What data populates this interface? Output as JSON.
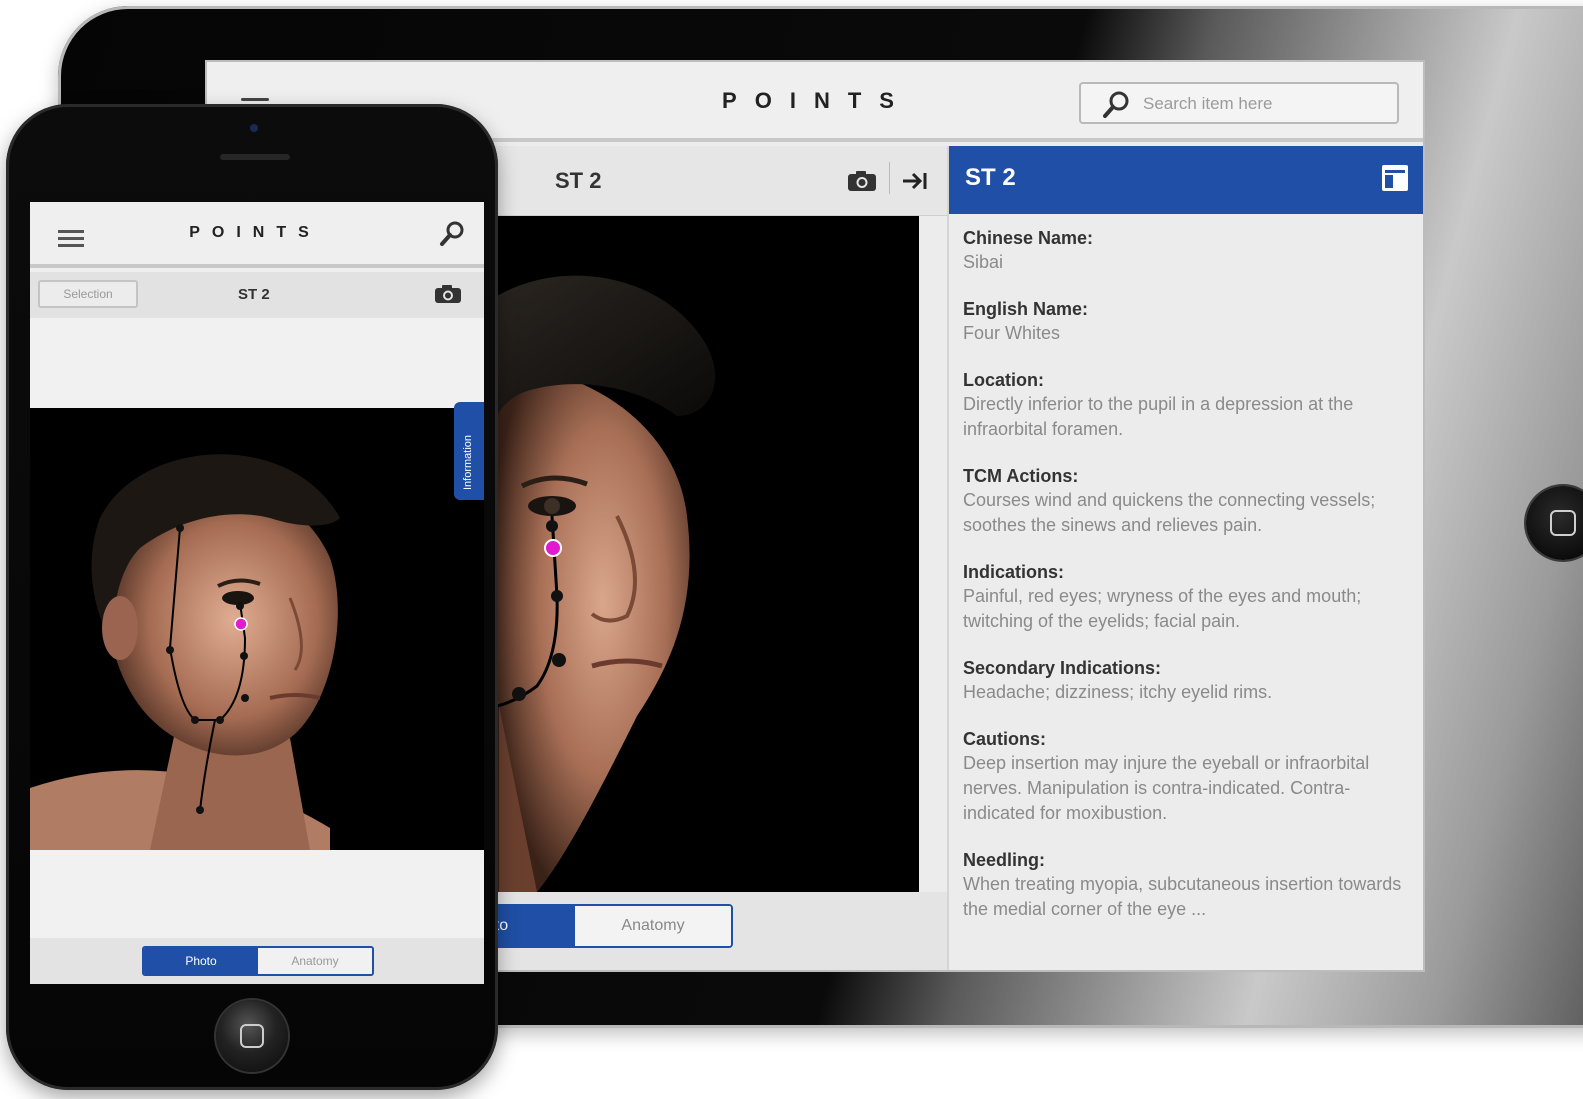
{
  "app": {
    "title": "POINTS",
    "point_code": "ST 2"
  },
  "tablet": {
    "search": {
      "placeholder": "Search item here"
    },
    "tabs": {
      "photo": "Photo",
      "anatomy": "Anatomy",
      "photo_visible": "oto"
    },
    "panel": {
      "title": "ST 2",
      "fields": [
        {
          "label": "Chinese Name:",
          "value": "Sibai"
        },
        {
          "label": "English Name:",
          "value": "Four Whites"
        },
        {
          "label": "Location:",
          "value": "Directly inferior to the pupil in a depression at the infraorbital foramen."
        },
        {
          "label": "TCM Actions:",
          "value": "Courses wind and quickens the connecting vessels; soothes the sinews and relieves pain."
        },
        {
          "label": "Indications:",
          "value": "Painful, red eyes; wryness of the eyes and mouth; twitching of the eyelids; facial pain."
        },
        {
          "label": "Secondary Indications:",
          "value": "Headache; dizziness; itchy eyelid rims."
        },
        {
          "label": "Cautions:",
          "value": "Deep insertion may injure the eyeball or infraorbital nerves. Manipulation is contra-indicated. Contra-indicated for moxibustion."
        },
        {
          "label": "Needling:",
          "value": "When treating myopia, subcutaneous insertion towards the medial corner of the eye ..."
        }
      ]
    }
  },
  "phone": {
    "selection_label": "Selection",
    "info_tab": "Information",
    "tabs": {
      "photo": "Photo",
      "anatomy": "Anatomy"
    }
  },
  "colors": {
    "accent": "#1f4fa6",
    "highlight_point": "#e21bd1",
    "point": "#111111"
  },
  "icons": [
    "menu-icon",
    "search-icon",
    "camera-icon",
    "collapse-panel-icon",
    "panel-toggle-icon",
    "home-button-icon"
  ]
}
